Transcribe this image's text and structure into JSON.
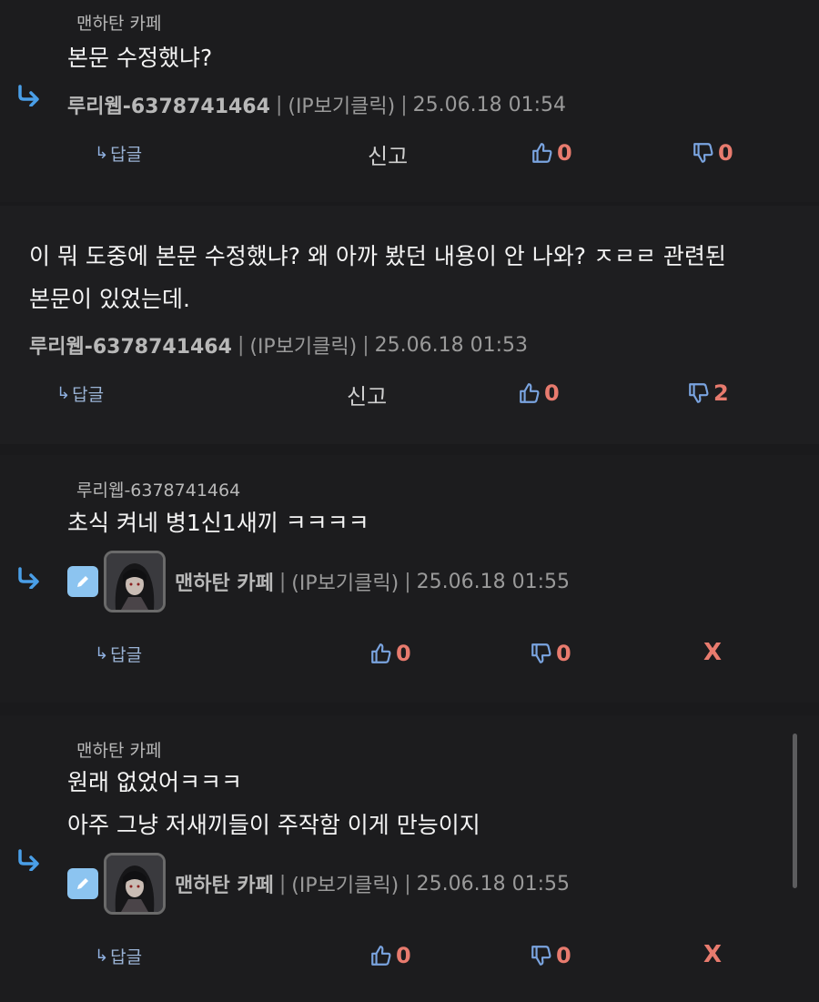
{
  "comments": [
    {
      "quote_author": "맨하탄 카페",
      "content_lines": [
        "본문 수정했냐?"
      ],
      "author": "루리웹-6378741464",
      "ip_label": "(IP보기클릭)",
      "timestamp": "25.06.18 01:54",
      "reply_label": "답글",
      "report_label": "신고",
      "likes": "0",
      "dislikes": "0"
    },
    {
      "content_lines": [
        "이 뭐 도중에 본문 수정했냐? 왜 아까 봤던 내용이 안 나와? ㅈㄹㄹ 관련된",
        "본문이 있었는데."
      ],
      "author": "루리웹-6378741464",
      "ip_label": "(IP보기클릭)",
      "timestamp": "25.06.18 01:53",
      "reply_label": "답글",
      "report_label": "신고",
      "likes": "0",
      "dislikes": "2"
    },
    {
      "quote_author": "루리웹-6378741464",
      "content_lines": [
        "초식 켜네 병1신1새끼 ㅋㅋㅋㅋ"
      ],
      "author": "맨하탄 카페",
      "ip_label": "(IP보기클릭)",
      "timestamp": "25.06.18 01:55",
      "reply_label": "답글",
      "likes": "0",
      "dislikes": "0",
      "delete_label": "X"
    },
    {
      "quote_author": "맨하탄 카페",
      "content_lines": [
        "원래 없었어ㅋㅋㅋ",
        "아주 그냥 저새끼들이 주작함 이게 만능이지"
      ],
      "author": "맨하탄 카페",
      "ip_label": "(IP보기클릭)",
      "timestamp": "25.06.18 01:55",
      "reply_label": "답글",
      "likes": "0",
      "dislikes": "0",
      "delete_label": "X"
    }
  ],
  "separator": "|",
  "reply_hook": "↳",
  "icons": {
    "reply_arrow": "reply-arrow-icon",
    "thumb_up": "thumb-up-icon",
    "thumb_down": "thumb-down-icon",
    "edit": "pencil-icon",
    "avatar": "avatar"
  },
  "colors": {
    "background": "#1a1a1c",
    "accent_blue": "#4a9fe8",
    "vote_red": "#e87b6e",
    "thumb_blue": "#7aa4e0"
  }
}
